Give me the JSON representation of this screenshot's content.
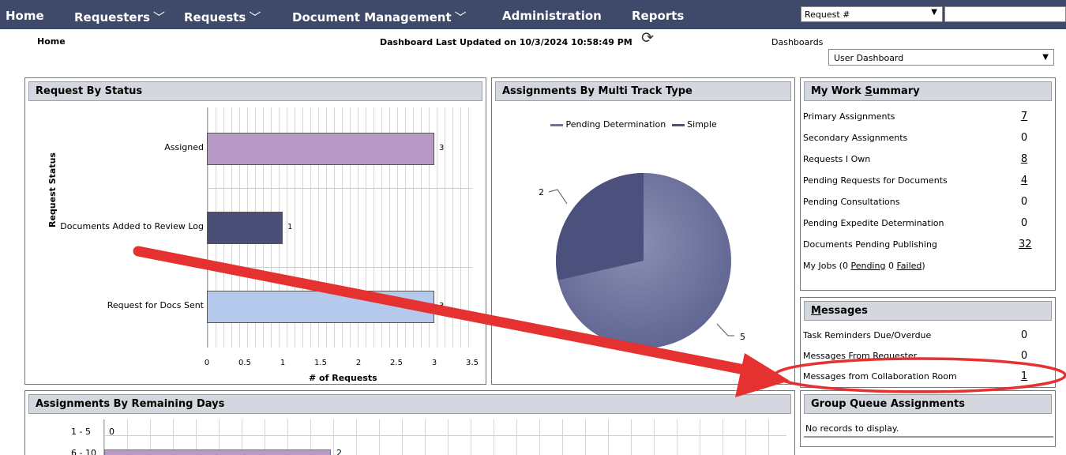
{
  "nav": {
    "home": "Home",
    "requesters": "Requesters",
    "requests": "Requests",
    "document_management": "Document Management",
    "administration": "Administration",
    "reports": "Reports",
    "search_type": "Request #",
    "search_value": ""
  },
  "subheader": {
    "breadcrumb": "Home",
    "last_updated": "Dashboard Last Updated on 10/3/2024 10:58:49 PM",
    "dashboards_label": "Dashboards",
    "dashboard_selected": "User Dashboard"
  },
  "request_by_status": {
    "title": "Request By Status",
    "chart_data": {
      "type": "bar",
      "orientation": "horizontal",
      "categories": [
        "Assigned",
        "Documents Added to Review Log",
        "Request for Docs Sent"
      ],
      "values": [
        3,
        1,
        3
      ],
      "labels": [
        "3",
        "1",
        "3"
      ],
      "colors": [
        "#b79ac6",
        "#4a4f78",
        "#b5c9ec"
      ],
      "xlabel": "# of Requests",
      "ylabel": "Request Status",
      "xlim": [
        0,
        3.5
      ],
      "xticks": [
        "0",
        "0.5",
        "1",
        "1.5",
        "2",
        "2.5",
        "3",
        "3.5"
      ],
      "grid": true
    }
  },
  "multi_track": {
    "title": "Assignments By Multi Track Type",
    "chart_data": {
      "type": "pie",
      "legend": [
        "Pending Determination",
        "Simple"
      ],
      "legend_position": "top",
      "values": [
        2,
        5
      ],
      "labels": [
        "2",
        "5"
      ],
      "colors": [
        "#4b507c",
        "#6d729a"
      ]
    }
  },
  "work_summary": {
    "title": "My Work Summary",
    "access_key_letter": "S",
    "rows": [
      {
        "label": "Primary Assignments",
        "value": "7",
        "link": true
      },
      {
        "label": "Secondary Assignments",
        "value": "0",
        "link": false
      },
      {
        "label": "Requests I Own",
        "value": "8",
        "link": true
      },
      {
        "label": "Pending Requests for Documents",
        "value": "4",
        "link": true
      },
      {
        "label": "Pending Consultations",
        "value": "0",
        "link": false
      },
      {
        "label": "Pending Expedite Determination",
        "value": "0",
        "link": false
      },
      {
        "label": "Documents Pending Publishing",
        "value": "32",
        "link": true
      }
    ],
    "jobs": {
      "prefix": "My Jobs (0 ",
      "pending": "Pending",
      "mid": " 0 ",
      "failed": "Failed",
      "suffix": ")"
    }
  },
  "messages": {
    "title": "Messages",
    "rows": [
      {
        "label": "Task Reminders Due/Overdue",
        "value": "0"
      },
      {
        "label": "Messages From Requester",
        "value": "0"
      },
      {
        "label": "Messages from Collaboration Room",
        "value": "1"
      }
    ]
  },
  "group_queue": {
    "title": "Group Queue Assignments",
    "empty_text": "No records to display."
  },
  "remaining_days": {
    "title": "Assignments By Remaining Days",
    "chart_data": {
      "type": "bar",
      "orientation": "horizontal",
      "categories": [
        "1 - 5",
        "6 - 10"
      ],
      "values": [
        0,
        null
      ],
      "labels": [
        "0",
        "2"
      ],
      "colors": [
        "#b79ac6"
      ]
    }
  },
  "colors": {
    "nav_bg": "#3f4a6b",
    "panel_header_bg": "#d5d7df",
    "annotation_red": "#e5312f"
  }
}
